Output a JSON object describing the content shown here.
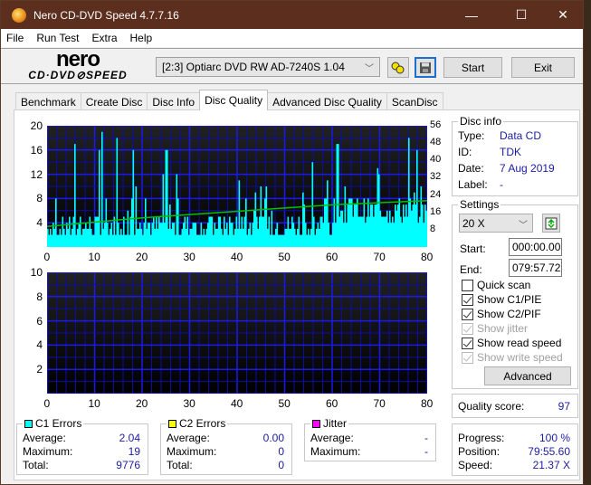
{
  "window": {
    "title": "Nero CD-DVD Speed 4.7.7.16",
    "minimize": "—",
    "maximize": "☐",
    "close": "✕"
  },
  "menu": [
    "File",
    "Run Test",
    "Extra",
    "Help"
  ],
  "logo": {
    "line1": "nero",
    "line2": "CD·DVD⊘SPEED"
  },
  "toolbar": {
    "drive": "[2:3]  Optiarc DVD RW AD-7240S 1.04",
    "start": "Start",
    "exit": "Exit",
    "icons": [
      "disc-eject-icon",
      "save-icon"
    ]
  },
  "tabs": [
    "Benchmark",
    "Create Disc",
    "Disc Info",
    "Disc Quality",
    "Advanced Disc Quality",
    "ScanDisc"
  ],
  "active_tab": "Disc Quality",
  "disc_info": {
    "title": "Disc info",
    "type_label": "Type:",
    "type": "Data CD",
    "id_label": "ID:",
    "id": "TDK",
    "date_label": "Date:",
    "date": "7 Aug 2019",
    "label_label": "Label:",
    "label": "-"
  },
  "settings": {
    "title": "Settings",
    "speed": "20 X",
    "start_label": "Start:",
    "start": "000:00.00",
    "end_label": "End:",
    "end": "079:57.72",
    "checkboxes": [
      {
        "label": "Quick scan",
        "checked": false,
        "enabled": true
      },
      {
        "label": "Show C1/PIE",
        "checked": true,
        "enabled": true
      },
      {
        "label": "Show C2/PIF",
        "checked": true,
        "enabled": true
      },
      {
        "label": "Show jitter",
        "checked": true,
        "enabled": false
      },
      {
        "label": "Show read speed",
        "checked": true,
        "enabled": true
      },
      {
        "label": "Show write speed",
        "checked": true,
        "enabled": false
      }
    ],
    "advanced": "Advanced"
  },
  "quality": {
    "label": "Quality score:",
    "value": "97"
  },
  "progress": {
    "progress_label": "Progress:",
    "progress": "100 %",
    "position_label": "Position:",
    "position": "79:55.60",
    "speed_label": "Speed:",
    "speed": "21.37 X"
  },
  "c1": {
    "title": "C1 Errors",
    "color": "#00ffff",
    "avg_label": "Average:",
    "avg": "2.04",
    "max_label": "Maximum:",
    "max": "19",
    "total_label": "Total:",
    "total": "9776"
  },
  "c2": {
    "title": "C2 Errors",
    "color": "#ffff00",
    "avg_label": "Average:",
    "avg": "0.00",
    "max_label": "Maximum:",
    "max": "0",
    "total_label": "Total:",
    "total": "0"
  },
  "jitter": {
    "title": "Jitter",
    "color": "#ff00ff",
    "avg_label": "Average:",
    "avg": "-",
    "max_label": "Maximum:",
    "max": "-"
  },
  "chart_data": [
    {
      "type": "bar",
      "title": "C1 Errors",
      "xlim": [
        0,
        80
      ],
      "ylim": [
        0,
        20
      ],
      "y2lim": [
        0,
        56
      ],
      "xticks": [
        "0",
        "10",
        "20",
        "30",
        "40",
        "50",
        "60",
        "70",
        "80"
      ],
      "yticks": [
        "4",
        "8",
        "12",
        "16",
        "20"
      ],
      "y2ticks": [
        "8",
        "16",
        "24",
        "32",
        "40",
        "48",
        "56"
      ],
      "series": [
        {
          "name": "C1",
          "color": "#00ffff",
          "note": "dense per-sample bars, mostly 1-8, peaks 19 near 11, 18 near 14 and 76"
        },
        {
          "name": "Read speed (X)",
          "color": "#00c000",
          "x": [
            0,
            10,
            20,
            30,
            40,
            50,
            60,
            70,
            80
          ],
          "values": [
            9.5,
            11.5,
            13.5,
            15,
            16.5,
            18,
            19.5,
            20.5,
            21.4
          ]
        }
      ]
    },
    {
      "type": "bar",
      "title": "C2 Errors",
      "xlim": [
        0,
        80
      ],
      "ylim": [
        0,
        10
      ],
      "xticks": [
        "0",
        "10",
        "20",
        "30",
        "40",
        "50",
        "60",
        "70",
        "80"
      ],
      "yticks": [
        "2",
        "4",
        "6",
        "8",
        "10"
      ],
      "series": [
        {
          "name": "C2",
          "color": "#ffff00",
          "values": []
        }
      ]
    }
  ]
}
